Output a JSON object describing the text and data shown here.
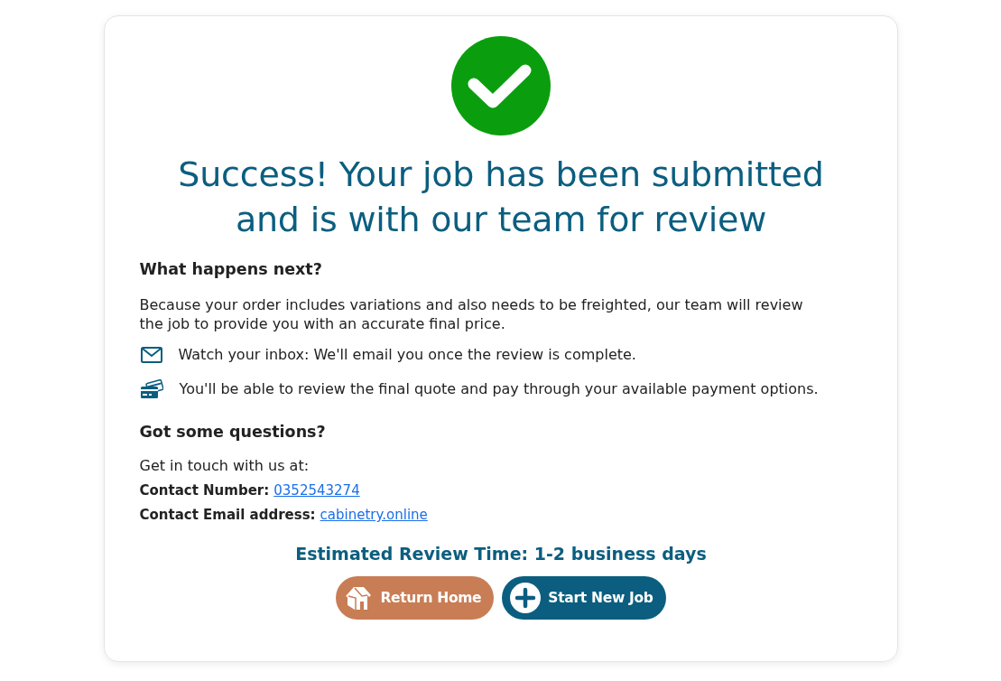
{
  "heading": "Success! Your job has been submitted and is with our team for review",
  "next_steps": {
    "title": "What happens next?",
    "text": "Because your order includes variations and also needs to be freighted, our team will review the job to provide you with an accurate final price.",
    "items": [
      {
        "kind": "email",
        "text": "Watch your inbox: We'll email you once the review is complete."
      },
      {
        "kind": "payment",
        "text": "You'll be able to review the final quote and pay through your available payment options."
      }
    ]
  },
  "questions": {
    "title": "Got some questions?",
    "intro": "Get in touch with us at:",
    "contacts": [
      {
        "label": "Contact Number:",
        "value": "0352543274"
      },
      {
        "label": "Contact Email address:",
        "value": "cabinetry.online"
      }
    ]
  },
  "review_time": "Estimated Review Time: 1-2 business days",
  "buttons": [
    {
      "kind": "home",
      "label": "Return Home"
    },
    {
      "kind": "new",
      "label": "Start New Job"
    }
  ]
}
